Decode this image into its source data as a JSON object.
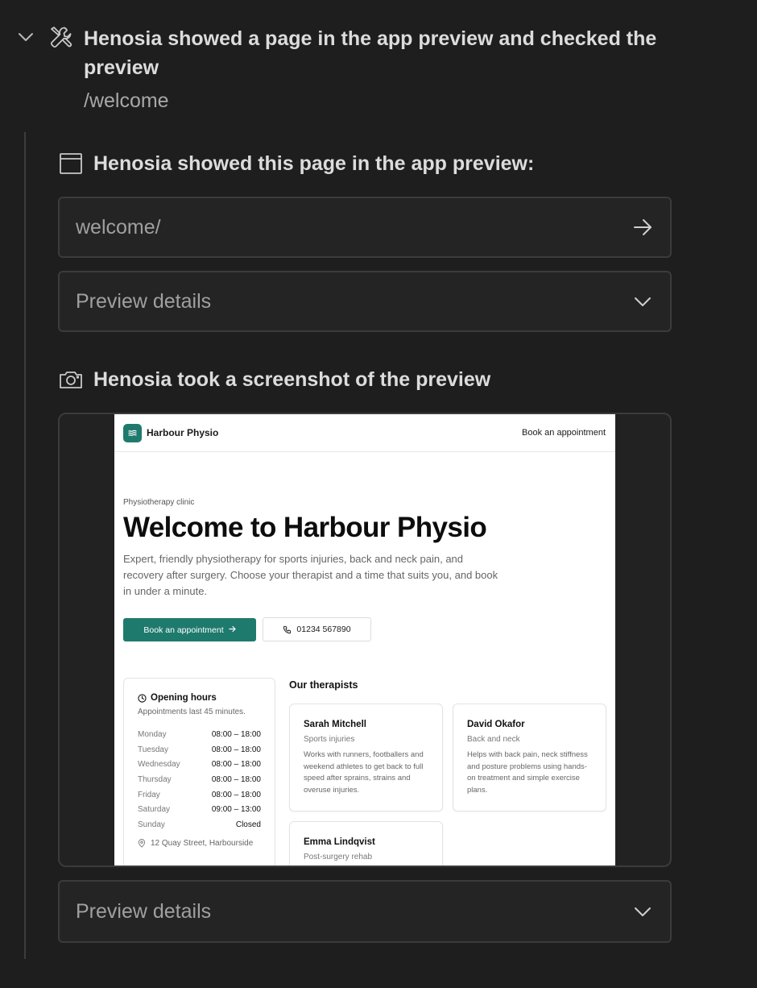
{
  "header": {
    "title": "Henosia showed a page in the app preview and checked the preview",
    "path": "/welcome"
  },
  "show_section": {
    "title": "Henosia showed this page in the app preview:",
    "url_value": "welcome/",
    "details_label": "Preview details"
  },
  "screenshot_section": {
    "title": "Henosia took a screenshot of the preview",
    "details_label": "Preview details"
  },
  "preview": {
    "brand": "Harbour Physio",
    "nav_link": "Book an appointment",
    "eyebrow": "Physiotherapy clinic",
    "heading": "Welcome to Harbour Physio",
    "lead": "Expert, friendly physiotherapy for sports injuries, back and neck pain, and recovery after surgery. Choose your therapist and a time that suits you, and book in under a minute.",
    "primary_button": "Book an appointment",
    "phone_button": "01234 567890",
    "hours": {
      "title": "Opening hours",
      "subtitle": "Appointments last 45 minutes.",
      "rows": [
        {
          "day": "Monday",
          "time": "08:00 – 18:00"
        },
        {
          "day": "Tuesday",
          "time": "08:00 – 18:00"
        },
        {
          "day": "Wednesday",
          "time": "08:00 – 18:00"
        },
        {
          "day": "Thursday",
          "time": "08:00 – 18:00"
        },
        {
          "day": "Friday",
          "time": "08:00 – 18:00"
        },
        {
          "day": "Saturday",
          "time": "09:00 – 13:00"
        },
        {
          "day": "Sunday",
          "time": "Closed"
        }
      ],
      "address": "12 Quay Street, Harbourside"
    },
    "therapists_title": "Our therapists",
    "therapists": [
      {
        "name": "Sarah Mitchell",
        "specialty": "Sports injuries",
        "description": "Works with runners, footballers and weekend athletes to get back to full speed after sprains, strains and overuse injuries."
      },
      {
        "name": "David Okafor",
        "specialty": "Back and neck",
        "description": "Helps with back pain, neck stiffness and posture problems using hands-on treatment and simple exercise plans."
      },
      {
        "name": "Emma Lindqvist",
        "specialty": "Post-surgery rehab",
        "description": ""
      }
    ]
  },
  "colors": {
    "background": "#1e1e1f",
    "box_border": "#3b3b3c",
    "accent_teal": "#1f7a6e"
  },
  "icons": {
    "header_chevron": "chevron-down-icon",
    "tool": "tools-icon",
    "window": "browser-window-icon",
    "go": "arrow-right-icon",
    "camera": "camera-icon",
    "details_chevron": "chevron-down-icon"
  }
}
